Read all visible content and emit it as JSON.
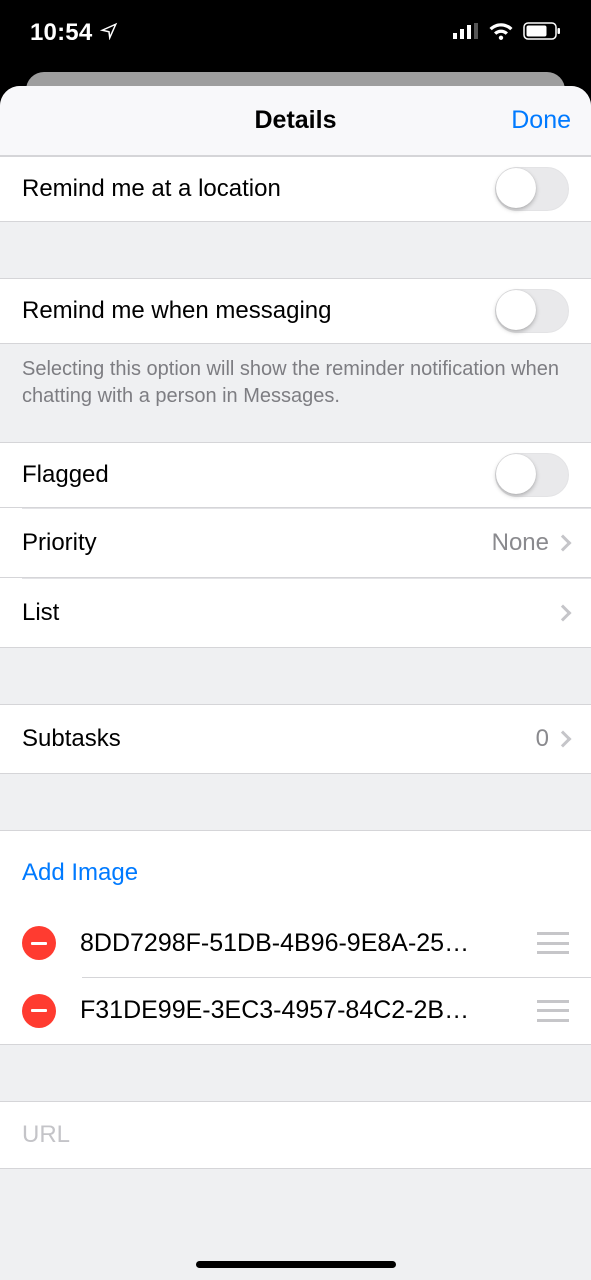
{
  "status_bar": {
    "time": "10:54"
  },
  "header": {
    "title": "Details",
    "done": "Done"
  },
  "location": {
    "label": "Remind me at a location",
    "on": false
  },
  "messaging": {
    "label": "Remind me when messaging",
    "on": false,
    "footer": "Selecting this option will show the reminder notification when chatting with a person in Messages."
  },
  "flags": {
    "flagged_label": "Flagged",
    "flagged_on": false,
    "priority_label": "Priority",
    "priority_value": "None",
    "list_label": "List",
    "list_value": ""
  },
  "subtasks": {
    "label": "Subtasks",
    "count": "0"
  },
  "images": {
    "add_label": "Add Image",
    "items": [
      {
        "name": "8DD7298F-51DB-4B96-9E8A-25…"
      },
      {
        "name": "F31DE99E-3EC3-4957-84C2-2B…"
      }
    ]
  },
  "url": {
    "placeholder": "URL",
    "value": ""
  }
}
